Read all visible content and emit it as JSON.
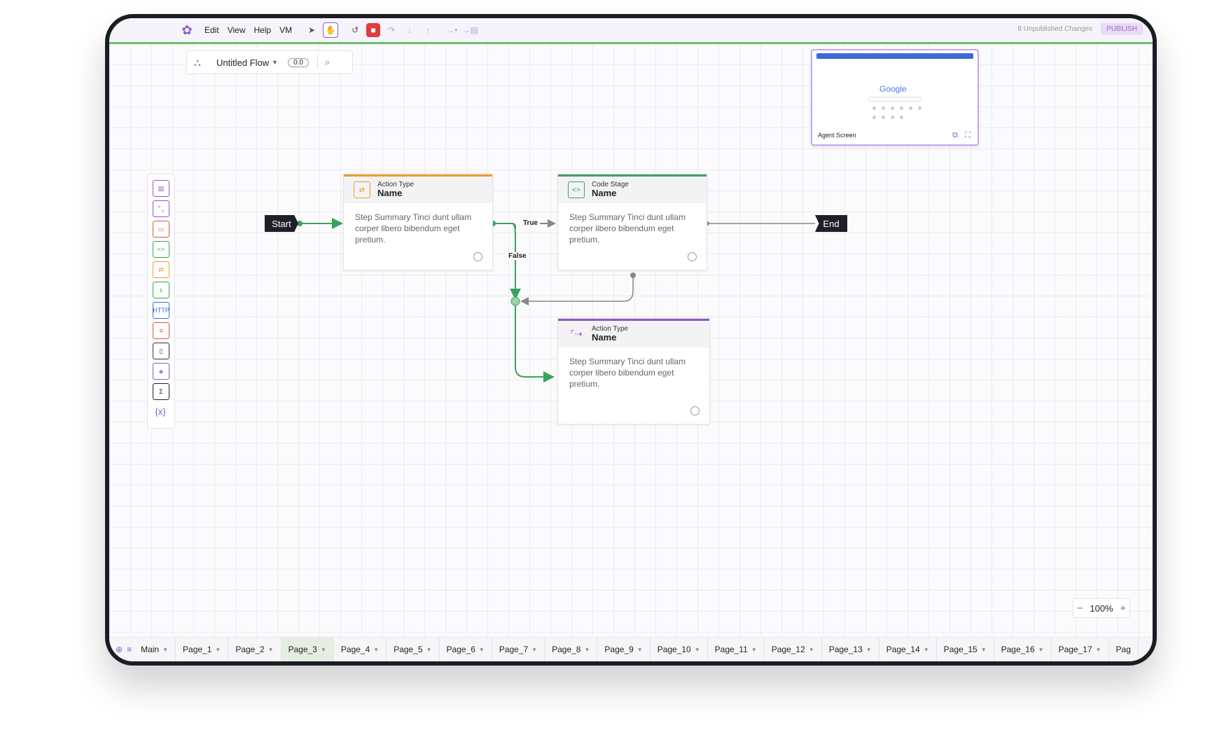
{
  "menu": [
    "Edit",
    "View",
    "Help",
    "VM"
  ],
  "top": {
    "unpublished": "8 Unpublished Changes",
    "publish": "PUBLISH"
  },
  "flow": {
    "name": "Untitled Flow",
    "version": "0.0"
  },
  "thumbnail": {
    "google": "Google",
    "label": "Agent Screen"
  },
  "palette": [
    {
      "icon": "chat-icon",
      "glyph": "▤",
      "color": "#8c59c8"
    },
    {
      "icon": "expand-icon",
      "glyph": "⌜⌟",
      "color": "#8c59c8"
    },
    {
      "icon": "window-icon",
      "glyph": "▭",
      "color": "#e0503b"
    },
    {
      "icon": "code-icon",
      "glyph": "&lt;&gt;",
      "color": "#3aa35a"
    },
    {
      "icon": "action-icon",
      "glyph": "⇄",
      "color": "#f09a2a"
    },
    {
      "icon": "calc-icon",
      "glyph": "±",
      "color": "#3aa35a"
    },
    {
      "icon": "http-icon",
      "glyph": "HTTP",
      "color": "#3a6bd6"
    },
    {
      "icon": "list-icon",
      "glyph": "≡",
      "color": "#e0503b"
    },
    {
      "icon": "file-icon",
      "glyph": "▯",
      "color": "#333"
    },
    {
      "icon": "cube-icon",
      "glyph": "◈",
      "color": "#8c59c8"
    },
    {
      "icon": "sigma-icon",
      "glyph": "Σ",
      "color": "#222"
    },
    {
      "icon": "variable-icon",
      "glyph": "{x}",
      "color": "#8c59c8"
    }
  ],
  "nodes": [
    {
      "type": "Action Type",
      "name": "Name",
      "summary": "Step Summary Tinci dunt ullam corper libero bibendum eget pretium."
    },
    {
      "type": "Code Stage",
      "name": "Name",
      "summary": "Step Summary Tinci dunt ullam corper libero bibendum eget pretium."
    },
    {
      "type": "Action Type",
      "name": "Name",
      "summary": "Step Summary Tinci dunt ullam corper libero bibendum eget pretium."
    }
  ],
  "terminals": {
    "start": "Start",
    "end": "End"
  },
  "edges": {
    "true_label": "True",
    "false_label": "False"
  },
  "zoom": {
    "level": "100%",
    "minus": "−",
    "plus": "+"
  },
  "tabs": [
    "Main",
    "Page_1",
    "Page_2",
    "Page_3",
    "Page_4",
    "Page_5",
    "Page_6",
    "Page_7",
    "Page_8",
    "Page_9",
    "Page_10",
    "Page_11",
    "Page_12",
    "Page_13",
    "Page_14",
    "Page_15",
    "Page_16",
    "Page_17",
    "Pag"
  ],
  "active_tab": "Page_3",
  "colors": {
    "accent": "#8c59c8",
    "green": "#3aa35a",
    "orange": "#f09a2a"
  }
}
